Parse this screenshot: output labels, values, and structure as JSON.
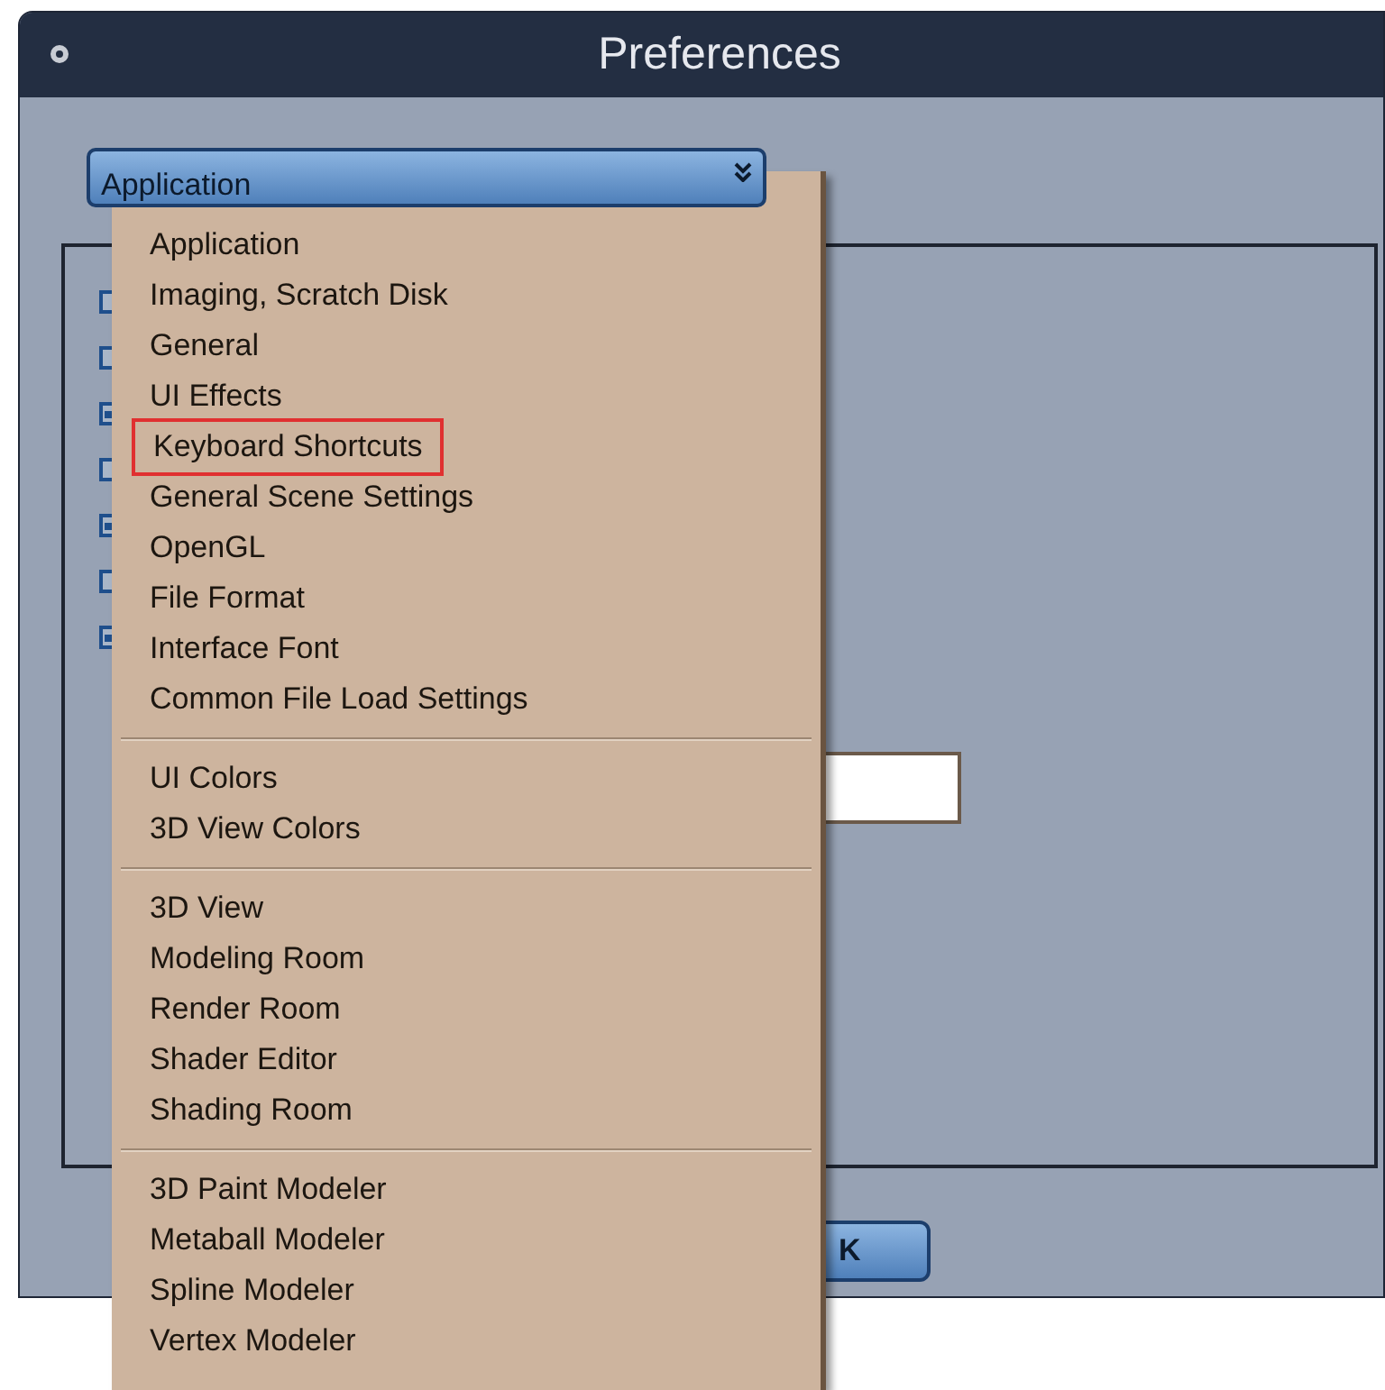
{
  "window": {
    "title": "Preferences"
  },
  "category_select": {
    "value": "Application"
  },
  "checkboxes": [
    {
      "kind": "checkbox",
      "checked": false
    },
    {
      "kind": "checkbox",
      "checked": false
    },
    {
      "kind": "checkbox",
      "checked": true
    },
    {
      "kind": "checkbox",
      "checked": false
    },
    {
      "kind": "checkbox",
      "checked": true
    },
    {
      "kind": "checkbox",
      "checked": false
    },
    {
      "kind": "checkbox",
      "checked": true
    }
  ],
  "text_field": {
    "kind": "field"
  },
  "ok_button": {
    "label": "K"
  },
  "dropdown_menu": {
    "groups": [
      {
        "items": [
          {
            "label": "Application",
            "selected": false
          },
          {
            "label": "Imaging, Scratch Disk",
            "selected": false
          },
          {
            "label": "General",
            "selected": false
          },
          {
            "label": "UI Effects",
            "selected": false
          },
          {
            "label": "Keyboard Shortcuts",
            "selected": true
          },
          {
            "label": "General Scene Settings",
            "selected": false
          },
          {
            "label": "OpenGL",
            "selected": false
          },
          {
            "label": "File Format",
            "selected": false
          },
          {
            "label": "Interface Font",
            "selected": false
          },
          {
            "label": "Common File Load Settings",
            "selected": false
          }
        ]
      },
      {
        "items": [
          {
            "label": "UI Colors",
            "selected": false
          },
          {
            "label": "3D View Colors",
            "selected": false
          }
        ]
      },
      {
        "items": [
          {
            "label": "3D View",
            "selected": false
          },
          {
            "label": "Modeling Room",
            "selected": false
          },
          {
            "label": "Render Room",
            "selected": false
          },
          {
            "label": "Shader Editor",
            "selected": false
          },
          {
            "label": "Shading Room",
            "selected": false
          }
        ]
      },
      {
        "items": [
          {
            "label": "3D Paint Modeler",
            "selected": false
          },
          {
            "label": "Metaball Modeler",
            "selected": false
          },
          {
            "label": "Spline Modeler",
            "selected": false
          },
          {
            "label": "Vertex Modeler",
            "selected": false
          }
        ]
      }
    ]
  }
}
